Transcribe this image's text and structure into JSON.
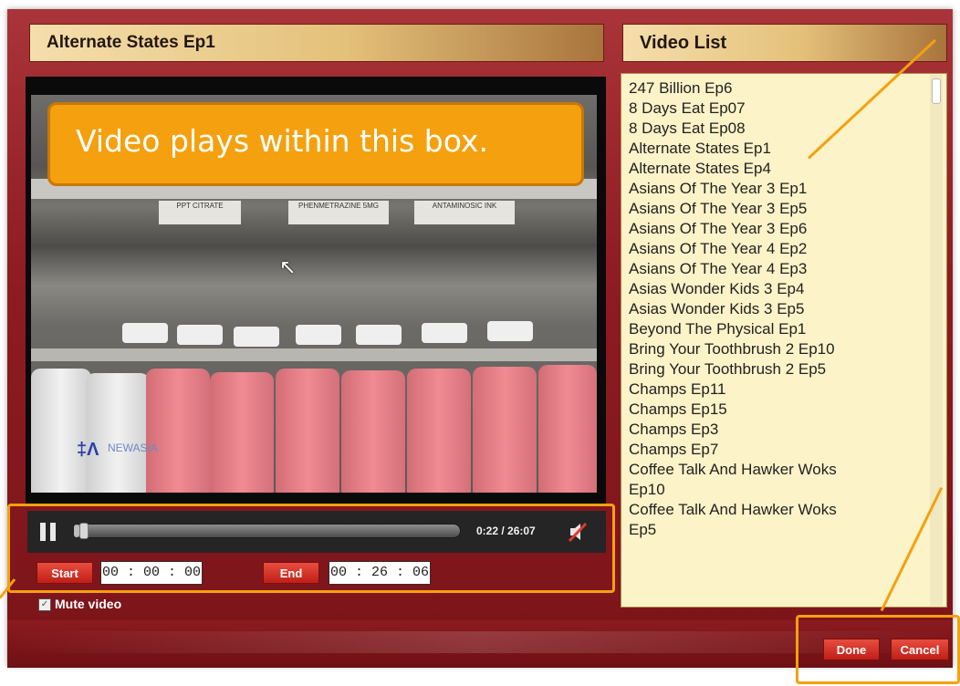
{
  "player": {
    "title": "Alternate States Ep1",
    "callout": "Video plays within this box.",
    "time_display": "0:22 / 26:07",
    "progress": 0.014,
    "start_label": "Start",
    "start_value": "00 : 00 : 00",
    "end_label": "End",
    "end_value": "00 : 26 : 06",
    "mute_label": "Mute video",
    "mute_checked": true,
    "shelf_labels": [
      "PPT CITRATE",
      "PHENMETRAZINE 5MG",
      "ANTAMINOSIC INK"
    ],
    "watermark": "NEWASIA"
  },
  "video_list": {
    "title": "Video List",
    "items": [
      "247 Billion Ep6",
      "8 Days Eat Ep07",
      "8 Days Eat Ep08",
      "Alternate States Ep1",
      "Alternate States Ep4",
      "Asians Of The Year 3 Ep1",
      "Asians Of The Year 3 Ep5",
      "Asians Of The Year 3 Ep6",
      "Asians Of The Year 4 Ep2",
      "Asians Of The Year 4 Ep3",
      "Asias Wonder Kids 3 Ep4",
      "Asias Wonder Kids 3 Ep5",
      "Beyond The Physical Ep1",
      "Bring Your Toothbrush 2 Ep10",
      "Bring Your Toothbrush 2 Ep5",
      "Champs Ep11",
      "Champs Ep15",
      "Champs Ep3",
      "Champs Ep7",
      "Coffee Talk And Hawker Woks",
      "Ep10",
      "Coffee Talk And Hawker Woks",
      "Ep5"
    ]
  },
  "footer": {
    "done_label": "Done",
    "cancel_label": "Cancel"
  },
  "colors": {
    "accent_orange": "#f5a00e",
    "button_red": "#d0281f",
    "list_bg": "#fdf3c8"
  }
}
